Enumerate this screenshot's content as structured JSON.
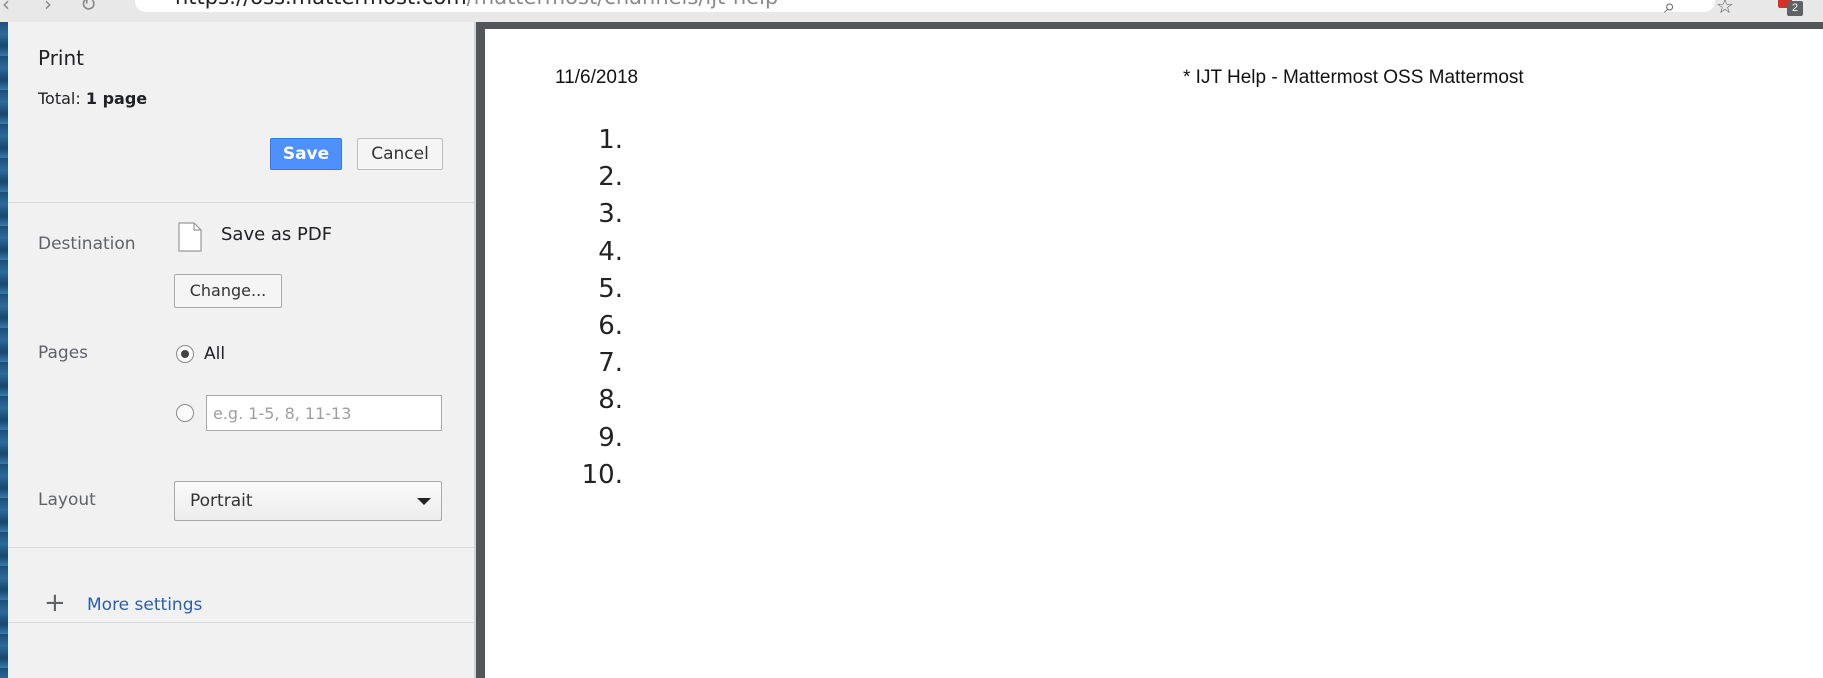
{
  "browser": {
    "url_host": "https://oss.mattermost.com",
    "url_path": "/mattermost/channels/ijt-help",
    "extension_badge": "2"
  },
  "print_panel": {
    "title": "Print",
    "total_label": "Total:",
    "total_value": "1 page",
    "save_label": "Save",
    "cancel_label": "Cancel",
    "destination": {
      "label": "Destination",
      "value": "Save as PDF",
      "change_label": "Change..."
    },
    "pages": {
      "label": "Pages",
      "all_label": "All",
      "selected": "All",
      "range_placeholder": "e.g. 1-5, 8, 11-13"
    },
    "layout": {
      "label": "Layout",
      "value": "Portrait"
    },
    "more_settings_label": "More settings"
  },
  "preview": {
    "header_date": "11/6/2018",
    "header_title": "* IJT Help - Mattermost OSS Mattermost",
    "list_numbers": [
      "1.",
      "2.",
      "3.",
      "4.",
      "5.",
      "6.",
      "7.",
      "8.",
      "9.",
      "10."
    ]
  },
  "colors": {
    "save_button": "#4d90fe",
    "link": "#2a5db0",
    "panel_bg": "#f1f1f1",
    "preview_bg": "#525659"
  }
}
